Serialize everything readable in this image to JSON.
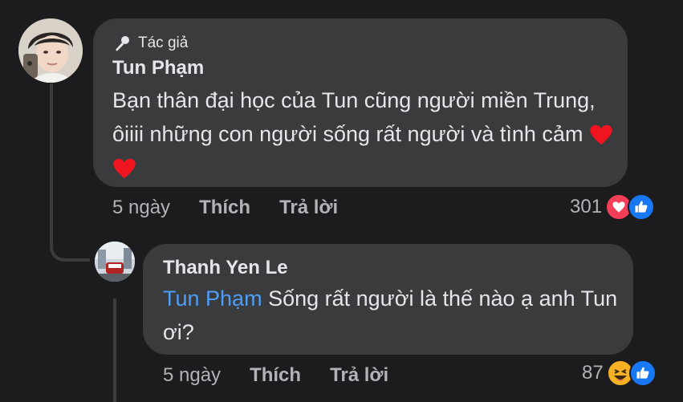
{
  "comment": {
    "author_badge": "Tác giả",
    "author_name": "Tun Phạm",
    "text": "Bạn thân đại học của Tun cũng người miền Trung, ôiiii những con người sống rất người và tình cảm",
    "time": "5 ngày",
    "like_label": "Thích",
    "reply_label": "Trả lời",
    "reaction_count": "301",
    "reaction_icons": [
      "love-icon",
      "like-icon"
    ]
  },
  "reply": {
    "author_name": "Thanh Yen Le",
    "mention": "Tun Phạm",
    "text": "Sống rất người là thế nào ạ anh Tun ơi?",
    "time": "5 ngày",
    "like_label": "Thích",
    "reply_label": "Trả lời",
    "reaction_count": "87",
    "reaction_icons": [
      "haha-icon",
      "like-icon"
    ]
  },
  "colors": {
    "background": "#1c1c1e",
    "bubble": "#3a3b3c",
    "mention": "#4e9df7",
    "secondary_text": "#b0b3b8",
    "love": "#f33e58",
    "like": "#1877f2",
    "haha": "#f7b125"
  }
}
